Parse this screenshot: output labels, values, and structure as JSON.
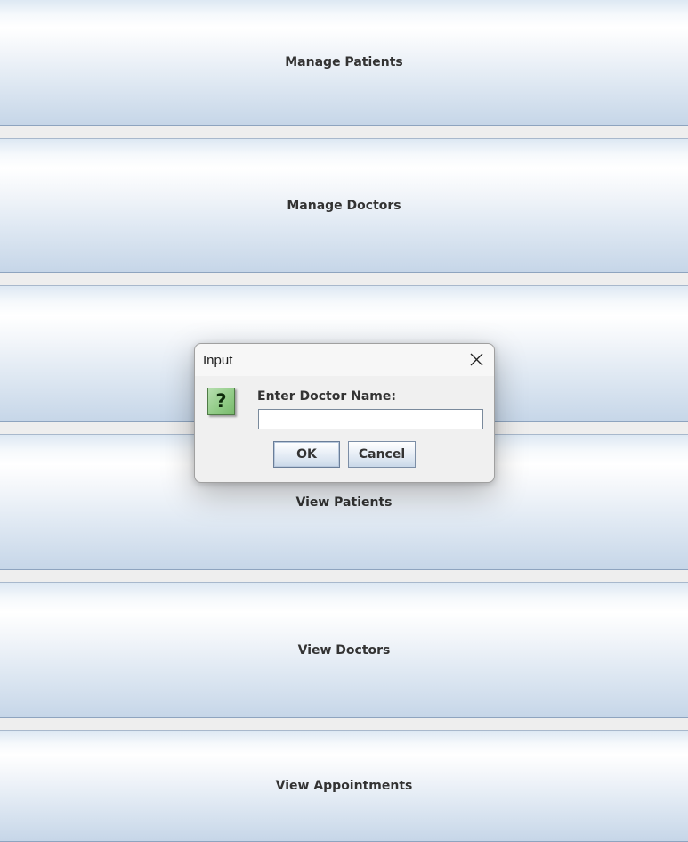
{
  "menu": {
    "buttons": [
      {
        "label": "Manage Patients"
      },
      {
        "label": "Manage Doctors"
      },
      {
        "label": ""
      },
      {
        "label": "View Patients"
      },
      {
        "label": "View Doctors"
      },
      {
        "label": "View Appointments"
      }
    ]
  },
  "dialog": {
    "title": "Input",
    "prompt": "Enter Doctor Name:",
    "input_value": "",
    "ok_label": "OK",
    "cancel_label": "Cancel",
    "icon": "question-icon",
    "icon_glyph": "?",
    "close_icon": "close-icon"
  },
  "colors": {
    "button_gradient_top": "#ffffff",
    "button_gradient_bottom": "#c6d6e8",
    "icon_green": "#8fca84",
    "dialog_bg": "#f0f0f0"
  }
}
